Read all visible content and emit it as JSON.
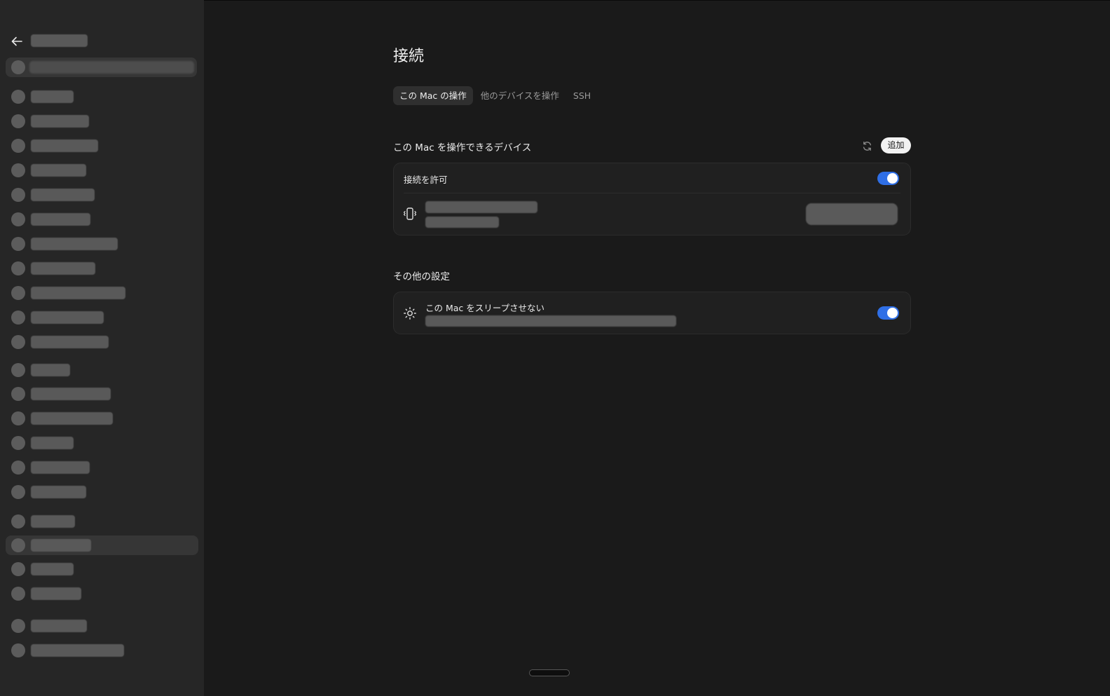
{
  "colors": {
    "background": "#1a1a1a",
    "sidebar": "#262626",
    "accent": "#2f6fe6",
    "card": "#202020"
  },
  "sidebar": {
    "back_icon": "arrow-left-icon",
    "items_redacted": true
  },
  "main": {
    "title": "接続",
    "tabs": [
      {
        "label": "この Mac の操作",
        "active": true
      },
      {
        "label": "他のデバイスを操作",
        "active": false
      },
      {
        "label": "SSH",
        "active": false
      }
    ],
    "devices_section": {
      "title": "この Mac を操作できるデバイス",
      "refresh_icon": "refresh-icon",
      "add_label": "追加",
      "allow_connection_label": "接続を許可",
      "allow_connection_on": true,
      "device_icon": "phone-vibrate-icon"
    },
    "other_section": {
      "title": "その他の設定",
      "sleep_label": "この Mac をスリープさせない",
      "sleep_icon": "sun-icon",
      "sleep_on": true
    }
  }
}
